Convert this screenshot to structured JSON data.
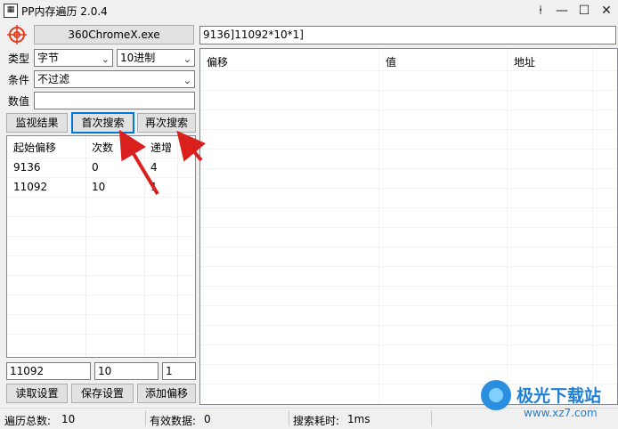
{
  "window": {
    "title": "PP内存遍历 2.0.4",
    "icon": "app-icon",
    "controls": [
      "pin-icon",
      "settings-icon",
      "maximize-icon",
      "close-icon"
    ]
  },
  "process_button": "360ChromeX.exe",
  "address_input": "9136]11092*10*1]",
  "type": {
    "label": "类型",
    "value": "字节"
  },
  "radix": {
    "value": "10进制"
  },
  "condition": {
    "label": "条件",
    "value": "不过滤"
  },
  "number": {
    "label": "数值",
    "value": ""
  },
  "buttons": {
    "monitor": "监视结果",
    "first_search": "首次搜索",
    "search_again": "再次搜索",
    "read_settings": "读取设置",
    "save_settings": "保存设置",
    "add_offset": "添加偏移"
  },
  "left_table": {
    "columns": [
      "起始偏移",
      "次数",
      "递增"
    ],
    "rows": [
      [
        "9136",
        "0",
        "4"
      ],
      [
        "11092",
        "10",
        "1"
      ]
    ]
  },
  "bottom_inputs": [
    "11092",
    "10",
    "1"
  ],
  "right_table": {
    "columns": [
      "偏移",
      "值",
      "地址"
    ]
  },
  "status": {
    "total_label": "遍历总数:",
    "total_value": "10",
    "valid_label": "有效数据:",
    "valid_value": "0",
    "time_label": "搜索耗时:",
    "time_value": "1ms"
  },
  "watermark": {
    "name": "极光下载站",
    "url": "www.xz7.com"
  },
  "colors": {
    "accent": "#0078d7",
    "annotation_arrow": "#d9201c",
    "watermark": "#1e7fd6"
  }
}
